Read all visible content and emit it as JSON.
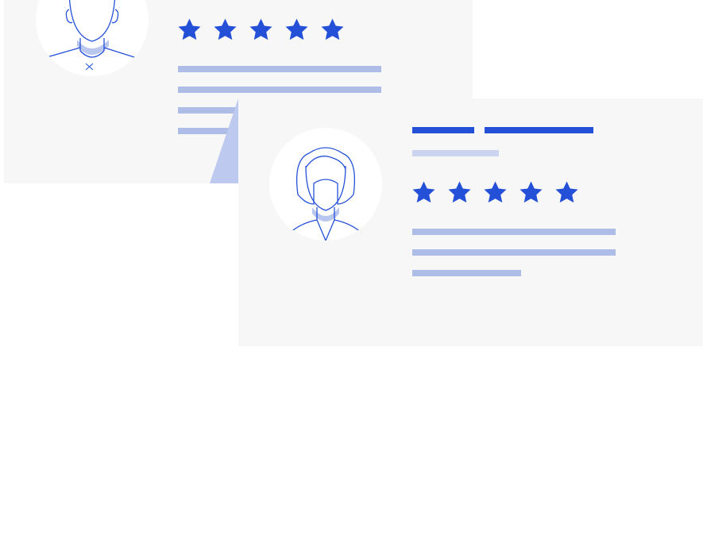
{
  "colors": {
    "card_bg": "#f7f7f8",
    "star": "#2450d8",
    "bar_dark": "#2450d8",
    "bar_light": "#aebde8",
    "bar_pale": "#cbd5f2",
    "outline": "#2450d8",
    "avatar_shadow": "#b9c6ee"
  },
  "reviews": [
    {
      "avatar": "male-avatar-icon",
      "rating": 5
    },
    {
      "avatar": "female-avatar-icon",
      "rating": 5
    }
  ]
}
